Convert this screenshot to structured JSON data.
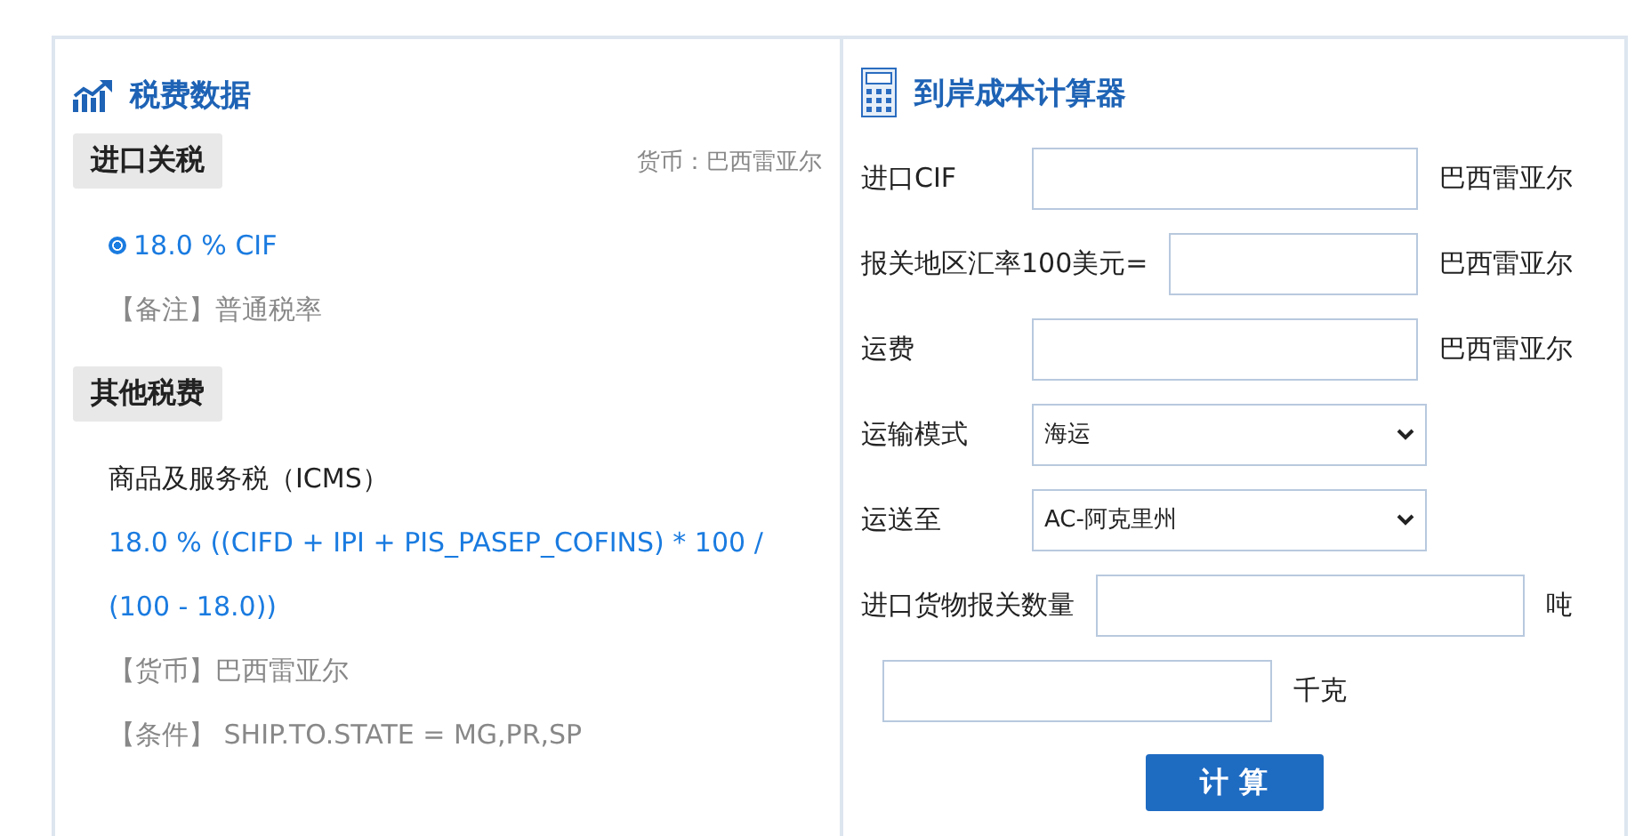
{
  "tax_panel": {
    "title": "税费数据",
    "sections": [
      {
        "heading": "进口关税",
        "currency_note": "货币：巴西雷亚尔",
        "items": [
          {
            "kind": "rate",
            "text": "18.0 % CIF",
            "selected": true
          },
          {
            "kind": "note",
            "text": "【备注】普通税率"
          }
        ]
      },
      {
        "heading": "其他税费",
        "items": [
          {
            "kind": "name",
            "text": "商品及服务税（ICMS）"
          },
          {
            "kind": "formula",
            "text": "18.0 % ((CIFD + IPI + PIS_PASEP_COFINS) * 100 / (100 - 18.0))"
          },
          {
            "kind": "note",
            "text": "【货币】巴西雷亚尔"
          },
          {
            "kind": "note",
            "text": "【条件】 SHIP.TO.STATE = MG,PR,SP"
          }
        ]
      }
    ]
  },
  "calculator": {
    "title": "到岸成本计算器",
    "fields": [
      {
        "kind": "input",
        "label": "进口CIF",
        "unit": "巴西雷亚尔"
      },
      {
        "kind": "input",
        "label": "报关地区汇率100美元=",
        "unit": "巴西雷亚尔"
      },
      {
        "kind": "input",
        "label": "运费",
        "unit": "巴西雷亚尔"
      },
      {
        "kind": "select",
        "label": "运输模式",
        "value": "海运"
      },
      {
        "kind": "select",
        "label": "运送至",
        "value": "AC-阿克里州"
      },
      {
        "kind": "input",
        "label": "进口货物报关数量",
        "unit": "吨"
      },
      {
        "kind": "input",
        "unit": "千克"
      }
    ],
    "button": "计 算"
  }
}
